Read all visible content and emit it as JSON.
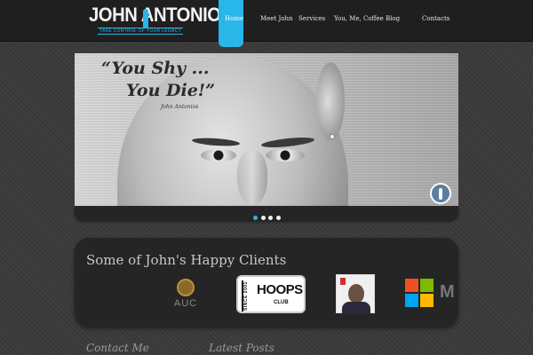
{
  "header": {
    "logo_text": "JOHN ANTONIOS",
    "logo_tagline": "TAKE CONTROL OF YOUR LEGACY",
    "nav": [
      {
        "label": "Home",
        "active": true
      },
      {
        "label": "Meet John",
        "active": false
      },
      {
        "label": "Services",
        "active": false
      },
      {
        "label": "You, Me, Coffee",
        "active": false
      },
      {
        "label": "Blog",
        "active": false
      },
      {
        "label": "Contacts",
        "active": false
      }
    ]
  },
  "slider": {
    "quote_line1": "“You Shy ...",
    "quote_line2": "You Die!”",
    "quote_author": "John Antonios",
    "dots": 4,
    "active_dot": 1
  },
  "clients": {
    "title": "Some of John's Happy Clients",
    "auc_label": "AUC",
    "hoops_since": "SINCE 2001",
    "hoops_word": "HOOPS",
    "hoops_club": "CLUB",
    "partial_logo": "M"
  },
  "footer": {
    "contact_heading": "Contact Me",
    "posts_heading": "Latest Posts"
  },
  "colors": {
    "accent": "#29b6e8",
    "header_bg": "#1f1f1f",
    "page_bg": "#3a3a3a",
    "panel_bg": "#252525"
  }
}
